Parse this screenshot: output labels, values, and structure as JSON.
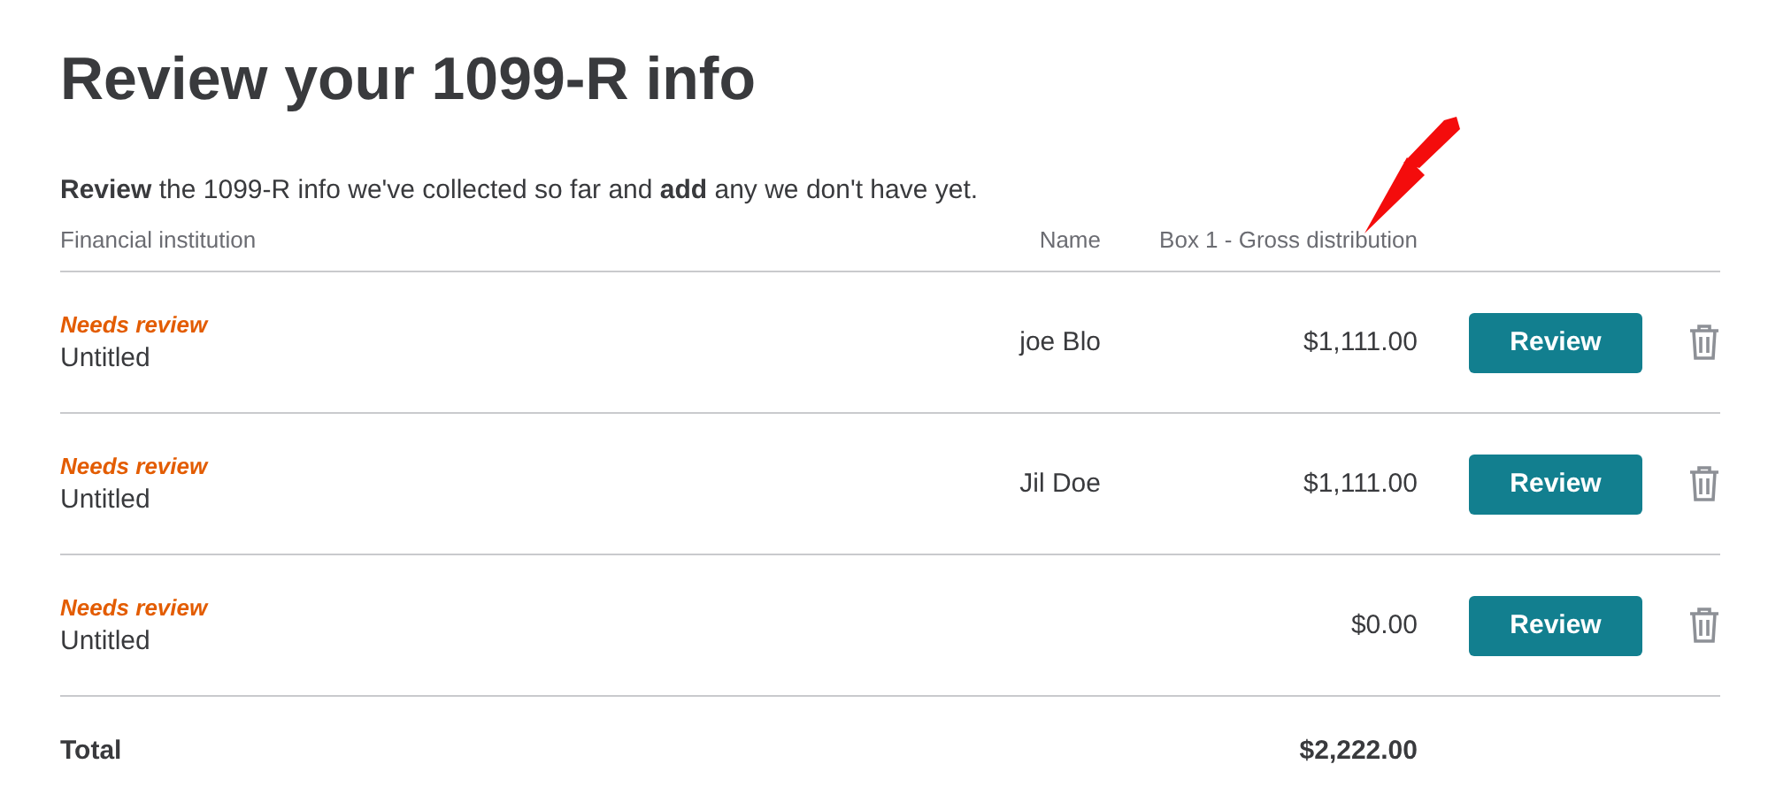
{
  "title": "Review your 1099-R info",
  "intro": "**Review** the 1099-R info we've collected so far and **add** any we don't have yet.",
  "table": {
    "columns": [
      "Financial institution",
      "Name",
      "Box 1 - Gross distribution"
    ],
    "rows": [
      {
        "status": "Needs review",
        "institution": "Untitled",
        "name": "joe Blo",
        "amount": "$1,111.00",
        "button": "Review"
      },
      {
        "status": "Needs review",
        "institution": "Untitled",
        "name": "Jil Doe",
        "amount": "$1,111.00",
        "button": "Review"
      },
      {
        "status": "Needs review",
        "institution": "Untitled",
        "amount": "$0.00",
        "button": "Review"
      }
    ],
    "total": {
      "label": "Total",
      "amount": "$2,222.00"
    }
  }
}
